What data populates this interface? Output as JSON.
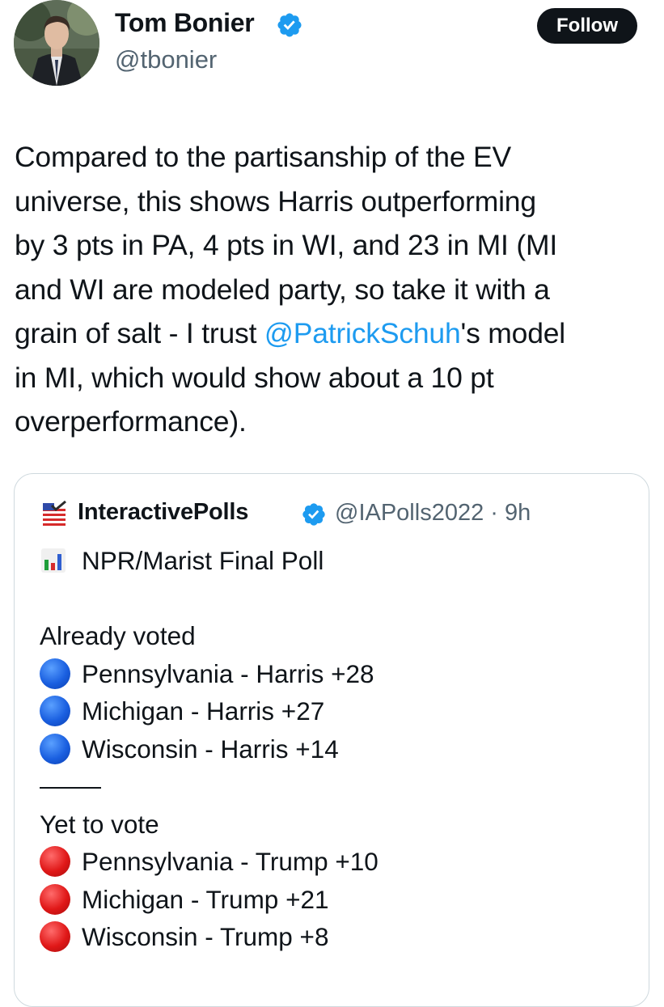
{
  "author": {
    "name": "Tom Bonier",
    "handle": "@tbonier",
    "verified": true
  },
  "follow_label": "Follow",
  "tweet": {
    "lines": [
      "Compared to the partisanship of the EV",
      "universe, this shows Harris outperforming",
      "by 3 pts in PA, 4 pts in WI, and 23 in MI (MI",
      "and WI are modeled party, so take it with a"
    ],
    "line5_before": "grain of salt - I trust ",
    "mention": "@PatrickSchuh",
    "line5_after": "'s model",
    "lines_end": [
      "in MI, which would show about a 10 pt",
      "overperformance)."
    ]
  },
  "quote": {
    "name": "InteractivePolls",
    "handle_time": "@IAPolls2022 · 9h",
    "title": "NPR/Marist Final Poll",
    "already_voted_label": "Already voted",
    "already_voted": [
      "Pennsylvania - Harris +28",
      "Michigan - Harris +27",
      "Wisconsin - Harris +14"
    ],
    "yet_to_vote_label": "Yet to vote",
    "yet_to_vote": [
      "Pennsylvania - Trump +10",
      "Michigan - Trump +21",
      "Wisconsin - Trump +8"
    ]
  },
  "colors": {
    "accent": "#1d9bf0",
    "text": "#0f1419",
    "muted": "#536471",
    "verified": "#1d9bf0"
  },
  "icons": {
    "verified": "verified-badge-icon",
    "chart": "bar-chart-emoji-icon",
    "flag": "us-ballot-flag-icon",
    "blue_dot": "blue-circle-icon",
    "red_dot": "red-circle-icon"
  }
}
